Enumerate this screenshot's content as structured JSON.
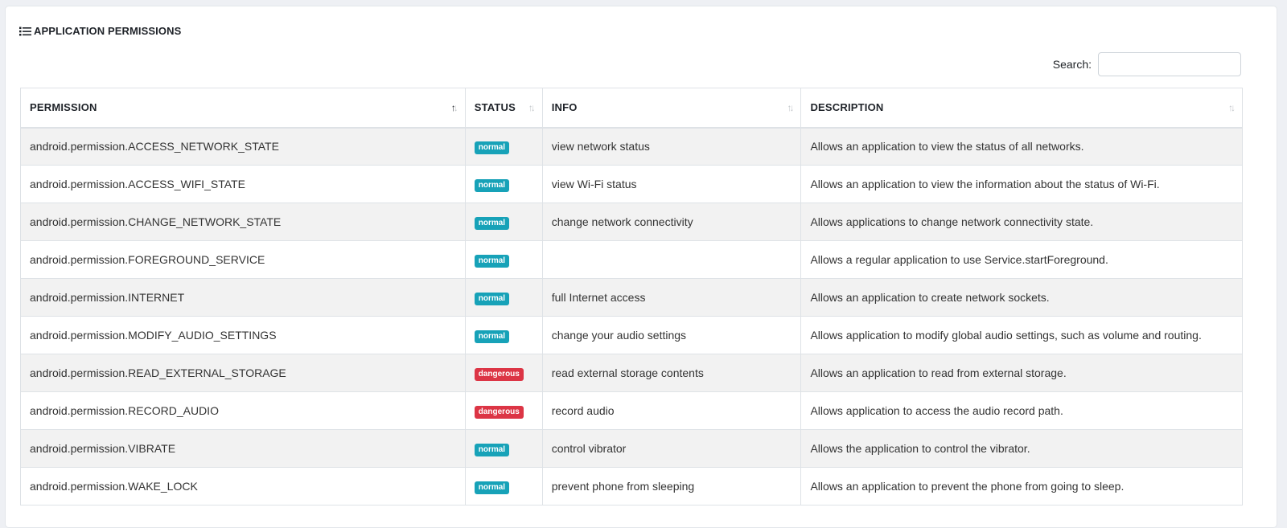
{
  "card": {
    "title": "APPLICATION PERMISSIONS",
    "title_icon": "list-icon"
  },
  "search": {
    "label": "Search:",
    "value": "",
    "placeholder": ""
  },
  "table": {
    "columns": [
      {
        "label": "PERMISSION",
        "sort": "ascending"
      },
      {
        "label": "STATUS",
        "sort": "none"
      },
      {
        "label": "INFO",
        "sort": "none"
      },
      {
        "label": "DESCRIPTION",
        "sort": "none"
      }
    ],
    "rows": [
      {
        "permission": "android.permission.ACCESS_NETWORK_STATE",
        "status": "normal",
        "info": "view network status",
        "description": "Allows an application to view the status of all networks."
      },
      {
        "permission": "android.permission.ACCESS_WIFI_STATE",
        "status": "normal",
        "info": "view Wi-Fi status",
        "description": "Allows an application to view the information about the status of Wi-Fi."
      },
      {
        "permission": "android.permission.CHANGE_NETWORK_STATE",
        "status": "normal",
        "info": "change network connectivity",
        "description": "Allows applications to change network connectivity state."
      },
      {
        "permission": "android.permission.FOREGROUND_SERVICE",
        "status": "normal",
        "info": "",
        "description": "Allows a regular application to use Service.startForeground."
      },
      {
        "permission": "android.permission.INTERNET",
        "status": "normal",
        "info": "full Internet access",
        "description": "Allows an application to create network sockets."
      },
      {
        "permission": "android.permission.MODIFY_AUDIO_SETTINGS",
        "status": "normal",
        "info": "change your audio settings",
        "description": "Allows application to modify global audio settings, such as volume and routing."
      },
      {
        "permission": "android.permission.READ_EXTERNAL_STORAGE",
        "status": "dangerous",
        "info": "read external storage contents",
        "description": "Allows an application to read from external storage."
      },
      {
        "permission": "android.permission.RECORD_AUDIO",
        "status": "dangerous",
        "info": "record audio",
        "description": "Allows application to access the audio record path."
      },
      {
        "permission": "android.permission.VIBRATE",
        "status": "normal",
        "info": "control vibrator",
        "description": "Allows the application to control the vibrator."
      },
      {
        "permission": "android.permission.WAKE_LOCK",
        "status": "normal",
        "info": "prevent phone from sleeping",
        "description": "Allows an application to prevent the phone from going to sleep."
      }
    ]
  },
  "colors": {
    "normal_badge": "#17a2b8",
    "dangerous_badge": "#dc3545",
    "stripe": "#f2f2f2"
  }
}
